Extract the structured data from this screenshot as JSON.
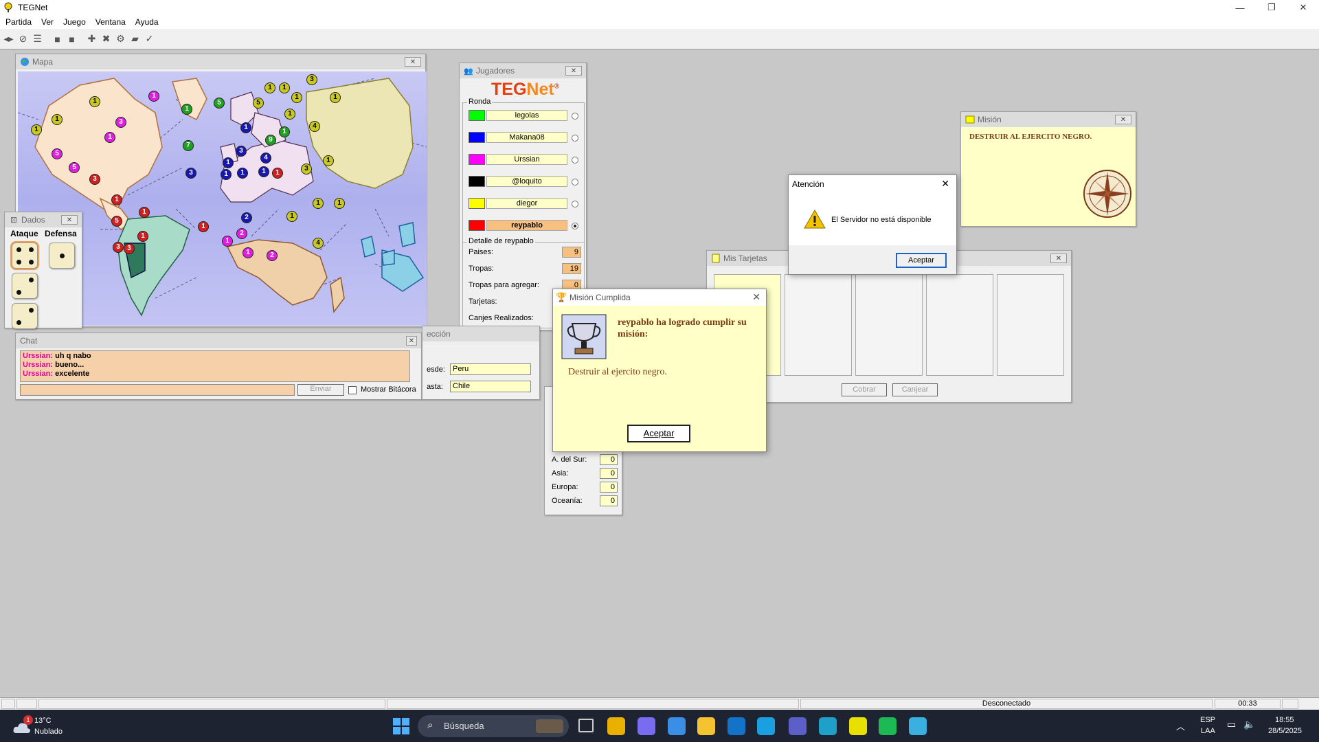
{
  "app": {
    "title": "TEGNet"
  },
  "window_controls": {
    "minimize": "—",
    "maximize": "❐",
    "close": "✕"
  },
  "menu": [
    "Partida",
    "Ver",
    "Juego",
    "Ventana",
    "Ayuda"
  ],
  "toolbar_icons": [
    "connect-icon",
    "disconnect-icon",
    "list-icon",
    "box1-icon",
    "box2-icon",
    "add-icon",
    "cancel-icon",
    "gear-icon",
    "card-icon",
    "check-icon"
  ],
  "map_window": {
    "title": "Mapa",
    "armies": [
      {
        "c": "#c8c820",
        "n": "1"
      },
      {
        "c": "#e020e0",
        "n": "1"
      },
      {
        "c": "#c8c820",
        "n": "1"
      },
      {
        "c": "#c8c820",
        "n": "1"
      },
      {
        "c": "#e020e0",
        "n": "3"
      },
      {
        "c": "#e020e0",
        "n": "1"
      },
      {
        "c": "#e020e0",
        "n": "5"
      },
      {
        "c": "#e020e0",
        "n": "5"
      },
      {
        "c": "#d02020",
        "n": "3"
      },
      {
        "c": "#d02020",
        "n": "1"
      },
      {
        "c": "#d02020",
        "n": "1"
      },
      {
        "c": "#d02020",
        "n": "5"
      },
      {
        "c": "#d02020",
        "n": "1"
      },
      {
        "c": "#d02020",
        "n": "3"
      },
      {
        "c": "#d02020",
        "n": "3"
      },
      {
        "c": "#20a020",
        "n": "1"
      },
      {
        "c": "#20a020",
        "n": "7"
      },
      {
        "c": "#20a020",
        "n": "5"
      },
      {
        "c": "#1818b0",
        "n": "1"
      },
      {
        "c": "#1818b0",
        "n": "1"
      },
      {
        "c": "#1818b0",
        "n": "1"
      },
      {
        "c": "#1818b0",
        "n": "3"
      },
      {
        "c": "#1818b0",
        "n": "3"
      },
      {
        "c": "#1818b0",
        "n": "1"
      },
      {
        "c": "#1818b0",
        "n": "4"
      },
      {
        "c": "#1818b0",
        "n": "1"
      },
      {
        "c": "#d02020",
        "n": "1"
      },
      {
        "c": "#20a020",
        "n": "9"
      },
      {
        "c": "#c8c820",
        "n": "5"
      },
      {
        "c": "#c8c820",
        "n": "1"
      },
      {
        "c": "#c8c820",
        "n": "1"
      },
      {
        "c": "#c8c820",
        "n": "1"
      },
      {
        "c": "#c8c820",
        "n": "3"
      },
      {
        "c": "#c8c820",
        "n": "1"
      },
      {
        "c": "#20a020",
        "n": "1"
      },
      {
        "c": "#c8c820",
        "n": "4"
      },
      {
        "c": "#c8c820",
        "n": "1"
      },
      {
        "c": "#c8c820",
        "n": "3"
      },
      {
        "c": "#c8c820",
        "n": "1"
      },
      {
        "c": "#c8c820",
        "n": "1"
      },
      {
        "c": "#c8c820",
        "n": "1"
      },
      {
        "c": "#c8c820",
        "n": "1"
      },
      {
        "c": "#c8c820",
        "n": "4"
      },
      {
        "c": "#d02020",
        "n": "1"
      },
      {
        "c": "#1818b0",
        "n": "2"
      },
      {
        "c": "#e020e0",
        "n": "2"
      },
      {
        "c": "#e020e0",
        "n": "1"
      },
      {
        "c": "#e020e0",
        "n": "1"
      },
      {
        "c": "#e020e0",
        "n": "2"
      }
    ]
  },
  "dice_window": {
    "title": "Dados",
    "attack_label": "Ataque",
    "defense_label": "Defensa",
    "attack": [
      4,
      2,
      2
    ],
    "defense": [
      1
    ]
  },
  "players_window": {
    "title": "Jugadores",
    "logo_teg": "TEG",
    "logo_net": "Net",
    "logo_reg": "®",
    "round_label": "Ronda",
    "players": [
      {
        "name": "legolas",
        "color": "#00ff00",
        "active": false
      },
      {
        "name": "Makana08",
        "color": "#0000ff",
        "active": false
      },
      {
        "name": "Urssian",
        "color": "#ff00ff",
        "active": false
      },
      {
        "name": "@loquito",
        "color": "#000000",
        "active": false
      },
      {
        "name": "diegor",
        "color": "#ffff00",
        "active": false
      },
      {
        "name": "reypablo",
        "color": "#ff0000",
        "active": true
      }
    ],
    "detail_label": "Detalle de reypablo",
    "rows": [
      {
        "label": "Paises:",
        "value": "9"
      },
      {
        "label": "Tropas:",
        "value": "19"
      },
      {
        "label": "Tropas para agregar:",
        "value": "0"
      },
      {
        "label": "Tarjetas:",
        "value": ""
      },
      {
        "label": "Canjes Realizados:",
        "value": ""
      }
    ]
  },
  "chat_window": {
    "title": "Chat",
    "messages": [
      {
        "user": "Urssian:",
        "text": "uh q nabo"
      },
      {
        "user": "Urssian:",
        "text": "bueno..."
      },
      {
        "user": "Urssian:",
        "text": "excelente"
      }
    ],
    "input_value": "",
    "send_label": "Enviar",
    "log_label": "Mostrar Bitácora"
  },
  "selection_window": {
    "title_fragment": "ección",
    "from_label": "esde:",
    "from_value": "Peru",
    "to_label": "asta:",
    "to_value": "Chile"
  },
  "continents_window": {
    "rows": [
      {
        "label": "A. del Sur:",
        "value": "0"
      },
      {
        "label": "Asia:",
        "value": "0"
      },
      {
        "label": "Europa:",
        "value": "0"
      },
      {
        "label": "Oceanía:",
        "value": "0"
      }
    ]
  },
  "mission_window": {
    "title": "Misión",
    "text": "DESTRUIR AL EJERCITO NEGRO."
  },
  "cards_window": {
    "title": "Mis Tarjetas",
    "collect_label": "Cobrar",
    "trade_label": "Canjear"
  },
  "attention_dialog": {
    "title": "Atención",
    "message": "El Servidor no está disponible",
    "ok_label": "Aceptar"
  },
  "mission_done_dialog": {
    "title": "Misión Cumplida",
    "headline": "reypablo ha logrado cumplir su misión:",
    "mission": "Destruir al ejercito negro.",
    "ok_label": "Aceptar"
  },
  "statusbar": {
    "status": "Desconectado",
    "time": "00:33"
  },
  "taskbar": {
    "weather_temp": "13°C",
    "weather_desc": "Nublado",
    "weather_badge": "1",
    "search_placeholder": "Búsqueda",
    "lang_top": "ESP",
    "lang_bottom": "LAA",
    "clock_time": "18:55",
    "clock_date": "28/5/2025",
    "apps": [
      {
        "name": "chrome-icon",
        "color": "#e8b000"
      },
      {
        "name": "copilot-icon",
        "color": "#7a6cf0"
      },
      {
        "name": "store-icon",
        "color": "#3a8ee6"
      },
      {
        "name": "files-icon",
        "color": "#f4c430"
      },
      {
        "name": "outlook-icon",
        "color": "#1273c8"
      },
      {
        "name": "app-arrow-icon",
        "color": "#1aa0e0"
      },
      {
        "name": "teams-icon",
        "color": "#5b5fc7"
      },
      {
        "name": "edge-icon",
        "color": "#1fa0c8"
      },
      {
        "name": "tegnet-icon",
        "color": "#e8e000"
      },
      {
        "name": "spotify-icon",
        "color": "#1db954"
      },
      {
        "name": "notepad-icon",
        "color": "#3ab0e0"
      }
    ]
  }
}
